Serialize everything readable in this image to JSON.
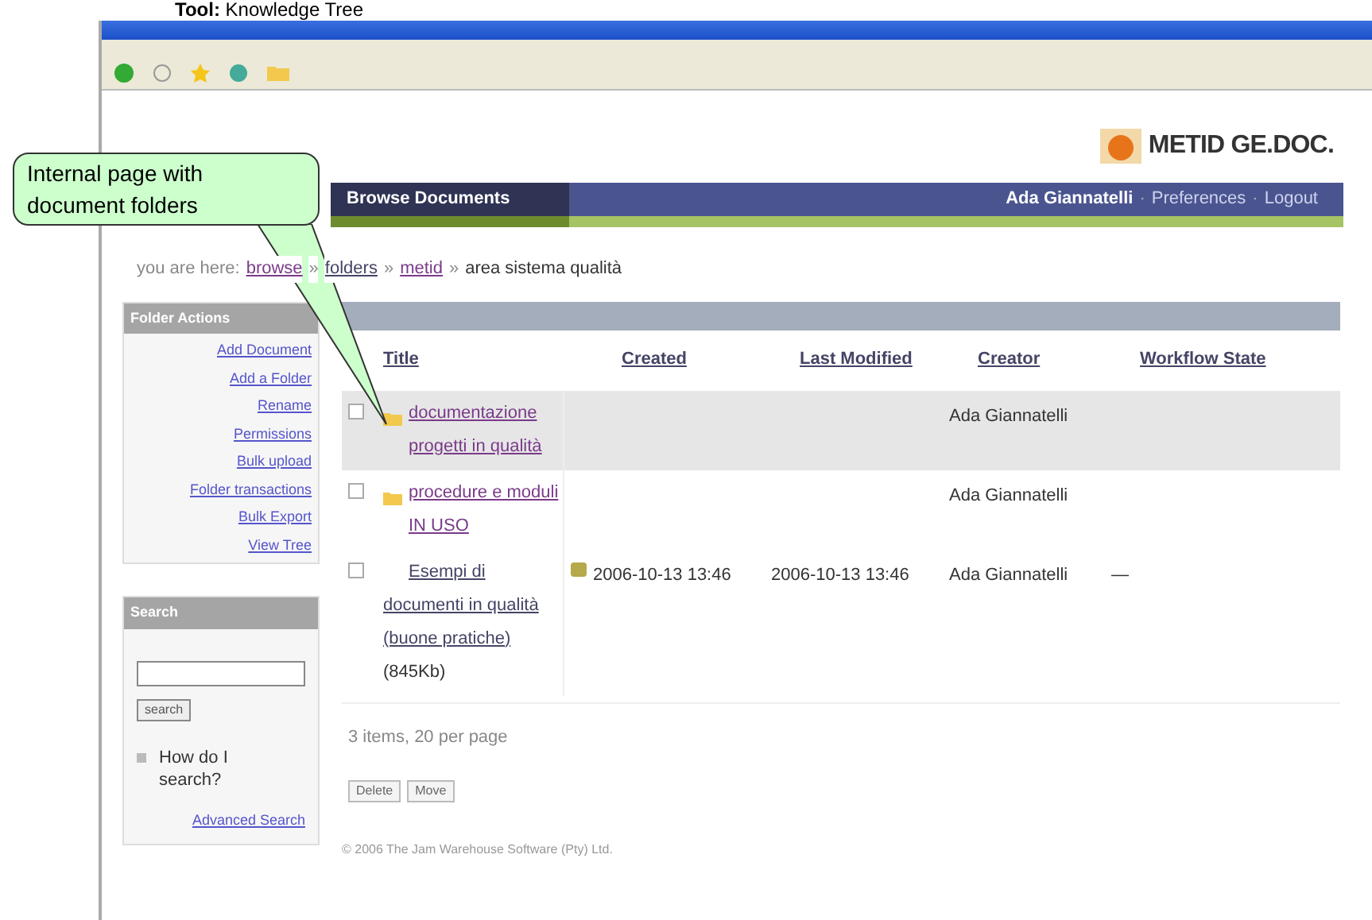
{
  "slide_title": "Tool: Knowledge Tree",
  "logo": {
    "text": "METID GE.DOC."
  },
  "nav": {
    "tab": "Browse Documents",
    "user": "Ada Giannatelli",
    "separator": "·",
    "links": [
      "Preferences",
      "Logout"
    ]
  },
  "breadcrumb": {
    "prefix": "you are here:",
    "separator": "»",
    "items": [
      "browse",
      "folders",
      "metid"
    ],
    "current": "area sistema qualità"
  },
  "sidebar": {
    "folder_actions": {
      "title": "Folder Actions",
      "links": [
        "Add Document",
        "Add a Folder",
        "Rename",
        "Permissions",
        "Bulk upload",
        "Folder transactions",
        "Bulk Export",
        "View Tree"
      ]
    },
    "search": {
      "title": "Search",
      "button": "search",
      "help": "How do I search?",
      "advanced": "Advanced Search"
    }
  },
  "table": {
    "columns": [
      "Title",
      "Created",
      "Last Modified",
      "Creator",
      "Workflow State"
    ],
    "rows": [
      {
        "kind": "folder",
        "checked": false,
        "highlighted": true,
        "title": "documentazione progetti in qualità",
        "creator": "Ada Giannatelli"
      },
      {
        "kind": "folder",
        "checked": false,
        "highlighted": false,
        "title": "procedure e moduli IN USO",
        "creator": "Ada Giannatelli"
      },
      {
        "kind": "document",
        "checked": false,
        "highlighted": false,
        "title": "Esempi di documenti in qualità (buone pratiche)",
        "size": "(845Kb)",
        "created": "2006-10-13 13:46",
        "modified": "2006-10-13 13:46",
        "creator": "Ada Giannatelli",
        "state": "—"
      }
    ]
  },
  "summary": "3 items, 20 per page",
  "buttons": [
    "Delete",
    "Move"
  ],
  "footer": "© 2006 The Jam Warehouse Software (Pty) Ltd.",
  "callout": {
    "text": "Internal page with document folders"
  }
}
